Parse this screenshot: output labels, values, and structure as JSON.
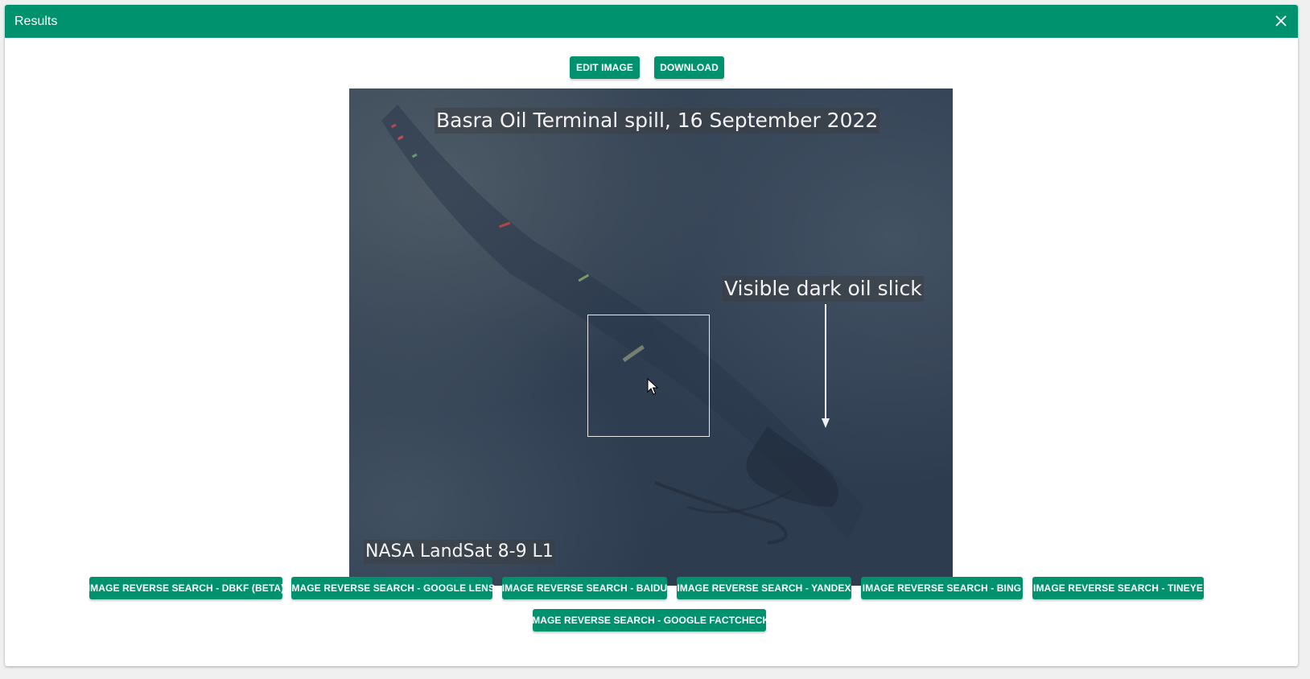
{
  "dialog": {
    "title": "Results",
    "close_icon": "close-icon"
  },
  "toolbar": {
    "edit_label": "EDIT IMAGE",
    "download_label": "DOWNLOAD"
  },
  "image": {
    "title_text": "Basra Oil Terminal spill, 16 September 2022",
    "annotation_text": "Visible dark oil slick",
    "credit_text": "NASA LandSat 8-9 L1"
  },
  "search_buttons": [
    "IMAGE REVERSE SEARCH - DBKF (BETA)",
    "IMAGE REVERSE SEARCH - GOOGLE LENS",
    "IMAGE REVERSE SEARCH - BAIDU",
    "IMAGE REVERSE SEARCH - YANDEX",
    "IMAGE REVERSE SEARCH - BING",
    "IMAGE REVERSE SEARCH - TINEYE",
    "IMAGE REVERSE SEARCH - GOOGLE FACTCHECK"
  ],
  "colors": {
    "accent": "#00926e",
    "header_text": "#ffffff",
    "background": "#f0f0f0"
  }
}
